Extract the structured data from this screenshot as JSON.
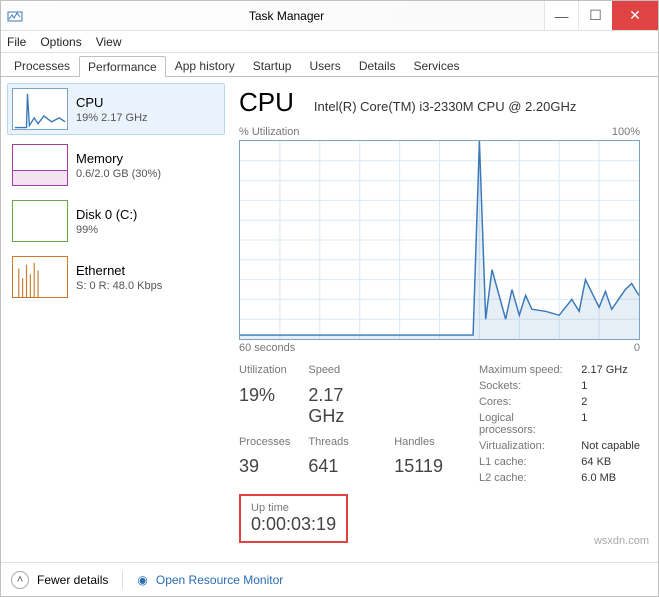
{
  "window": {
    "title": "Task Manager"
  },
  "menu": {
    "file": "File",
    "options": "Options",
    "view": "View"
  },
  "tabs": {
    "processes": "Processes",
    "performance": "Performance",
    "apphistory": "App history",
    "startup": "Startup",
    "users": "Users",
    "details": "Details",
    "services": "Services"
  },
  "sidebar": {
    "cpu": {
      "name": "CPU",
      "sub": "19%  2.17 GHz"
    },
    "memory": {
      "name": "Memory",
      "sub": "0.6/2.0 GB (30%)"
    },
    "disk": {
      "name": "Disk 0 (C:)",
      "sub": "99%"
    },
    "eth": {
      "name": "Ethernet",
      "sub": "S: 0 R: 48.0 Kbps"
    }
  },
  "panel": {
    "heading": "CPU",
    "model": "Intel(R) Core(TM) i3-2330M CPU @ 2.20GHz",
    "util_label": "% Utilization",
    "hundred": "100%",
    "sixty": "60 seconds",
    "zero": "0",
    "stats": {
      "utilization_lbl": "Utilization",
      "utilization": "19%",
      "speed_lbl": "Speed",
      "speed": "2.17 GHz",
      "processes_lbl": "Processes",
      "processes": "39",
      "threads_lbl": "Threads",
      "threads": "641",
      "handles_lbl": "Handles",
      "handles": "15119"
    },
    "right": {
      "maxspeed_k": "Maximum speed:",
      "maxspeed_v": "2.17 GHz",
      "sockets_k": "Sockets:",
      "sockets_v": "1",
      "cores_k": "Cores:",
      "cores_v": "2",
      "lp_k": "Logical processors:",
      "lp_v": "1",
      "virt_k": "Virtualization:",
      "virt_v": "Not capable",
      "l1_k": "L1 cache:",
      "l1_v": "64 KB",
      "l2_k": "L2 cache:",
      "l2_v": "6.0 MB"
    },
    "uptime_lbl": "Up time",
    "uptime": "0:00:03:19"
  },
  "footer": {
    "fewer": "Fewer details",
    "orm": "Open Resource Monitor"
  },
  "watermark": "wsxdn.com",
  "chart_data": {
    "type": "line",
    "title": "% Utilization",
    "xlabel": "60 seconds",
    "ylabel": "% Utilization",
    "ylim": [
      0,
      100
    ],
    "xlim": [
      60,
      0
    ],
    "x": [
      60,
      25,
      24,
      23,
      22,
      20,
      19,
      18,
      17,
      16,
      14,
      12,
      10,
      9,
      8,
      6,
      5,
      4,
      2,
      1,
      0
    ],
    "values": [
      2,
      2,
      100,
      10,
      35,
      10,
      25,
      12,
      22,
      15,
      14,
      12,
      20,
      14,
      30,
      16,
      24,
      15,
      25,
      28,
      22
    ]
  }
}
